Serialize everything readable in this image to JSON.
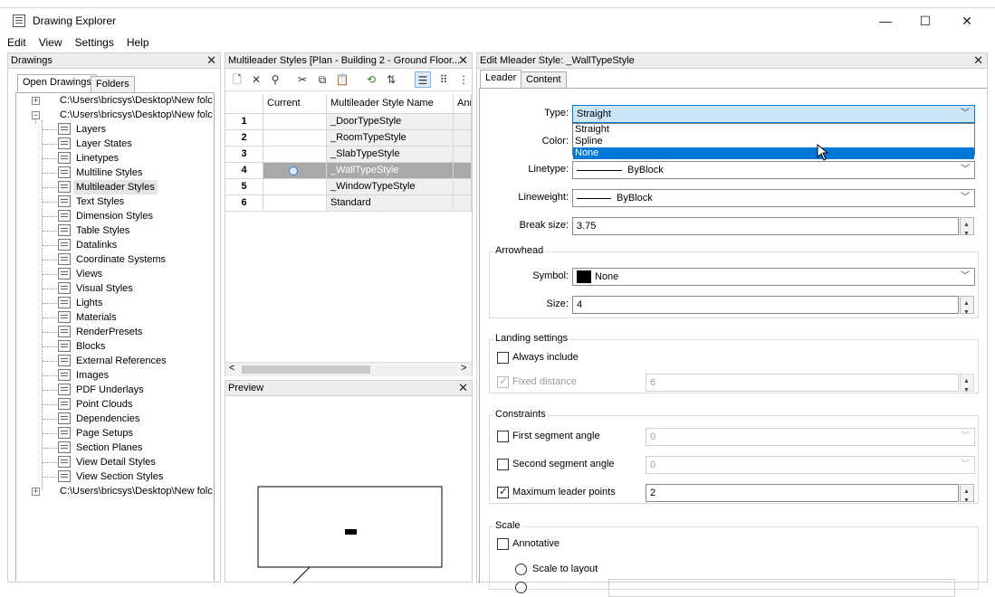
{
  "window": {
    "title": "Drawing Explorer"
  },
  "menu": [
    "Edit",
    "View",
    "Settings",
    "Help"
  ],
  "drawings_panel": {
    "title": "Drawings",
    "tabs": [
      "Open Drawings",
      "Folders"
    ],
    "root_items": [
      "C:\\Users\\bricsys\\Desktop\\New folc",
      "C:\\Users\\bricsys\\Desktop\\New folc",
      "C:\\Users\\bricsys\\Desktop\\New folc"
    ],
    "children": [
      {
        "label": "Layers",
        "icon": "layers-icon"
      },
      {
        "label": "Layer States",
        "icon": "layer-states-icon"
      },
      {
        "label": "Linetypes",
        "icon": "linetypes-icon"
      },
      {
        "label": "Multiline Styles",
        "icon": "multiline-styles-icon"
      },
      {
        "label": "Multileader Styles",
        "icon": "multileader-styles-icon"
      },
      {
        "label": "Text Styles",
        "icon": "text-styles-icon"
      },
      {
        "label": "Dimension Styles",
        "icon": "dimension-styles-icon"
      },
      {
        "label": "Table Styles",
        "icon": "table-styles-icon"
      },
      {
        "label": "Datalinks",
        "icon": "datalinks-icon"
      },
      {
        "label": "Coordinate Systems",
        "icon": "coordinate-systems-icon"
      },
      {
        "label": "Views",
        "icon": "views-icon"
      },
      {
        "label": "Visual Styles",
        "icon": "visual-styles-icon"
      },
      {
        "label": "Lights",
        "icon": "lights-icon"
      },
      {
        "label": "Materials",
        "icon": "materials-icon"
      },
      {
        "label": "RenderPresets",
        "icon": "render-presets-icon"
      },
      {
        "label": "Blocks",
        "icon": "blocks-icon"
      },
      {
        "label": "External References",
        "icon": "external-references-icon"
      },
      {
        "label": "Images",
        "icon": "images-icon"
      },
      {
        "label": "PDF Underlays",
        "icon": "pdf-underlays-icon"
      },
      {
        "label": "Point Clouds",
        "icon": "point-clouds-icon"
      },
      {
        "label": "Dependencies",
        "icon": "dependencies-icon"
      },
      {
        "label": "Page Setups",
        "icon": "page-setups-icon"
      },
      {
        "label": "Section Planes",
        "icon": "section-planes-icon"
      },
      {
        "label": "View Detail Styles",
        "icon": "view-detail-styles-icon"
      },
      {
        "label": "View Section Styles",
        "icon": "view-section-styles-icon"
      }
    ]
  },
  "styles_panel": {
    "title": "Multileader Styles [Plan - Building 2 - Ground Floor...",
    "columns": [
      "Current",
      "Multileader Style Name",
      "Anr"
    ],
    "rows": [
      {
        "num": "1",
        "name": "_DoorTypeStyle"
      },
      {
        "num": "2",
        "name": "_RoomTypeStyle"
      },
      {
        "num": "3",
        "name": "_SlabTypeStyle"
      },
      {
        "num": "4",
        "name": "_WallTypeStyle"
      },
      {
        "num": "5",
        "name": "_WindowTypeStyle"
      },
      {
        "num": "6",
        "name": "Standard"
      }
    ],
    "scroll_left": "<",
    "scroll_right": ">"
  },
  "preview_panel": {
    "title": "Preview"
  },
  "edit_panel": {
    "title": "Edit Mleader Style: _WallTypeStyle",
    "tabs": [
      "Leader",
      "Content"
    ],
    "type": {
      "label": "Type:",
      "value": "Straight",
      "options": [
        "Straight",
        "Spline",
        "None"
      ]
    },
    "color": {
      "label": "Color:"
    },
    "linetype": {
      "label": "Linetype:",
      "value": "ByBlock"
    },
    "lineweight": {
      "label": "Lineweight:",
      "value": "ByBlock"
    },
    "break_size": {
      "label": "Break size:",
      "value": "3.75"
    },
    "arrowhead": {
      "title": "Arrowhead",
      "symbol_label": "Symbol:",
      "symbol_value": "None",
      "size_label": "Size:",
      "size_value": "4"
    },
    "landing": {
      "title": "Landing settings",
      "always_include": "Always include",
      "fixed_distance": "Fixed distance",
      "fixed_distance_value": "6"
    },
    "constraints": {
      "title": "Constraints",
      "first_angle": "First segment angle",
      "first_angle_value": "0",
      "second_angle": "Second segment angle",
      "second_angle_value": "0",
      "max_points": "Maximum leader points",
      "max_points_value": "2"
    },
    "scale": {
      "title": "Scale",
      "annotative": "Annotative",
      "scale_to_layout": "Scale to layout"
    }
  }
}
